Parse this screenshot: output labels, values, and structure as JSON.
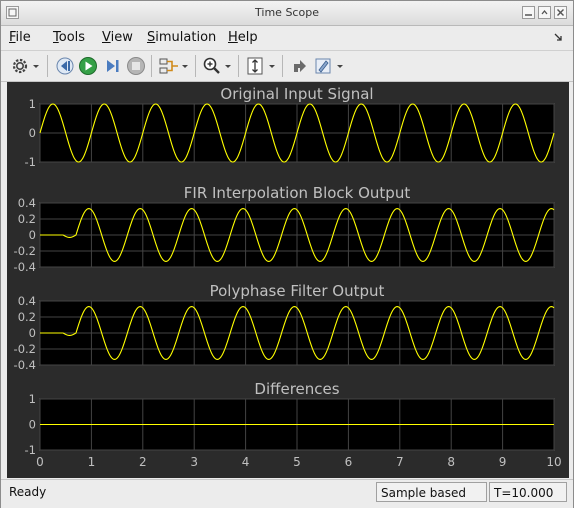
{
  "window": {
    "title": "Time Scope"
  },
  "menu": [
    {
      "label": "File",
      "mnemonic": "F",
      "rest": "ile"
    },
    {
      "label": "Tools",
      "mnemonic": "T",
      "rest": "ools"
    },
    {
      "label": "View",
      "mnemonic": "V",
      "rest": "iew"
    },
    {
      "label": "Simulation",
      "mnemonic": "S",
      "rest": "imulation"
    },
    {
      "label": "Help",
      "mnemonic": "H",
      "rest": "elp"
    }
  ],
  "toolbar_icons": [
    "gear-icon",
    "dropdown-arrow-icon",
    "step-back-icon",
    "run-icon",
    "step-forward-icon",
    "stop-icon",
    "signal-select-icon",
    "dropdown-arrow-icon",
    "zoom-in-icon",
    "dropdown-arrow-icon",
    "scale-axes-icon",
    "dropdown-arrow-icon",
    "measure-icon",
    "highlight-icon",
    "dropdown-arrow-icon"
  ],
  "status": {
    "state": "Ready",
    "mode": "Sample based",
    "time": "T=10.000"
  },
  "colors": {
    "background": "#2b2b2b",
    "plot_bg": "#000000",
    "trace": "#ffff00",
    "grid": "#444444",
    "text": "#c0c0c0"
  },
  "chart_data": [
    {
      "type": "line",
      "title": "Original Input Signal",
      "xlim": [
        0,
        10
      ],
      "ylim": [
        -1,
        1
      ],
      "yticks": [
        "1",
        "0",
        "-1"
      ],
      "ytick_values": [
        1,
        0,
        -1
      ],
      "series": [
        {
          "signal": "sine",
          "amplitude": 1,
          "frequency": 1,
          "delay": 0
        }
      ]
    },
    {
      "type": "line",
      "title": "FIR Interpolation Block Output",
      "xlim": [
        0,
        10
      ],
      "ylim": [
        -0.4,
        0.4
      ],
      "yticks": [
        "0.4",
        "0.2",
        "0",
        "-0.2",
        "-0.4"
      ],
      "ytick_values": [
        0.4,
        0.2,
        0,
        -0.2,
        -0.4
      ],
      "series": [
        {
          "signal": "sine",
          "amplitude": 0.33,
          "frequency": 1,
          "delay": 0.7
        }
      ]
    },
    {
      "type": "line",
      "title": "Polyphase Filter Output",
      "xlim": [
        0,
        10
      ],
      "ylim": [
        -0.4,
        0.4
      ],
      "yticks": [
        "0.4",
        "0.2",
        "0",
        "-0.2",
        "-0.4"
      ],
      "ytick_values": [
        0.4,
        0.2,
        0,
        -0.2,
        -0.4
      ],
      "series": [
        {
          "signal": "sine",
          "amplitude": 0.33,
          "frequency": 1,
          "delay": 0.7
        }
      ]
    },
    {
      "type": "line",
      "title": "Differences",
      "xlim": [
        0,
        10
      ],
      "ylim": [
        -1,
        1
      ],
      "yticks": [
        "1",
        "0",
        "-1"
      ],
      "ytick_values": [
        1,
        0,
        -1
      ],
      "xticks": [
        "0",
        "1",
        "2",
        "3",
        "4",
        "5",
        "6",
        "7",
        "8",
        "9",
        "10"
      ],
      "series": [
        {
          "signal": "constant",
          "value": 0
        }
      ]
    }
  ]
}
